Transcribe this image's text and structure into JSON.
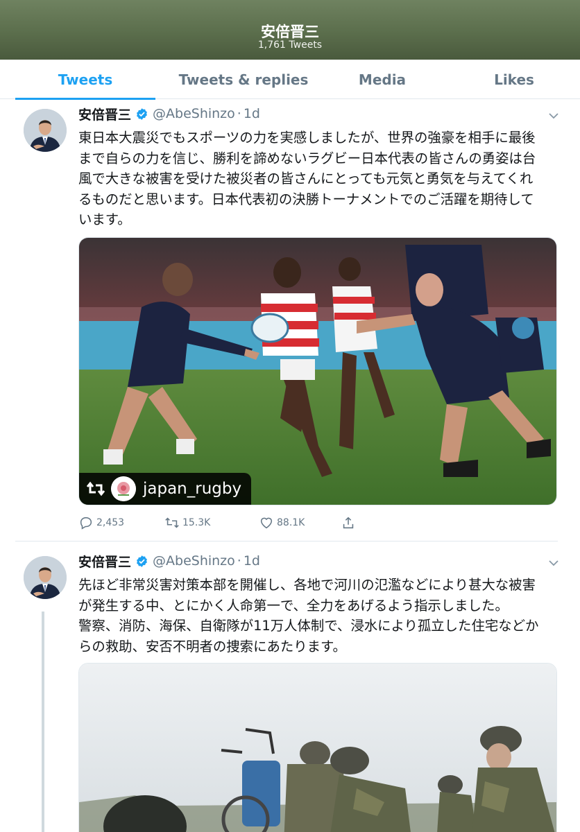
{
  "header": {
    "name": "安倍晋三",
    "tweet_count": "1,761 Tweets"
  },
  "tabs": [
    {
      "label": "Tweets",
      "active": true
    },
    {
      "label": "Tweets & replies",
      "active": false
    },
    {
      "label": "Media",
      "active": false
    },
    {
      "label": "Likes",
      "active": false
    }
  ],
  "tweets": [
    {
      "display_name": "安倍晋三",
      "handle": "@AbeShinzo",
      "separator": "·",
      "time": "1d",
      "text": "東日本大震災でもスポーツの力を実感しましたが、世界の強豪を相手に最後まで自ら の力を信じ、勝利を諦めないラグビー日本代表の皆さんの勇姿は台風で大きな被害を受けた被災者の皆さんにとっても元気と勇気を与えてくれるものだと思います。日本代表初の決勝トーナメントでのご活躍を期待しています。",
      "text_lines": [
        "東日本大震災でもスポーツの力を実感しましたが、世界の強豪を相手に最後",
        "まで自らの力を信じ、勝利を諦めないラグビー日本代表の皆さんの勇姿は台",
        "風で大きな被害を受けた被災者の皆さんにとっても元気と勇気を与えてくれ",
        "るものだと思います。日本代表初の決勝トーナメントでのご活躍を期待して",
        "います。"
      ],
      "media_attribution": "japan_rugby",
      "replies": "2,453",
      "retweets": "15.3K",
      "likes": "88.1K"
    },
    {
      "display_name": "安倍晋三",
      "handle": "@AbeShinzo",
      "separator": "·",
      "time": "1d",
      "text_lines": [
        "先ほど非常災害対策本部を開催し、各地で河川の氾濫などにより甚大な被害",
        "が発生する中、とにかく人命第一で、全力をあげるよう指示しました。",
        "警察、消防、海保、自衛隊が11万人体制で、浸水により孤立した住宅などか",
        "らの救助、安否不明者の捜索にあたります。"
      ]
    }
  ],
  "colors": {
    "accent": "#1da1f2",
    "secondary_text": "#657786",
    "verified": "#1da1f2"
  },
  "icons": [
    "verified-icon",
    "chevron-down-icon",
    "retweet-icon",
    "reply-icon",
    "like-icon",
    "share-icon"
  ]
}
